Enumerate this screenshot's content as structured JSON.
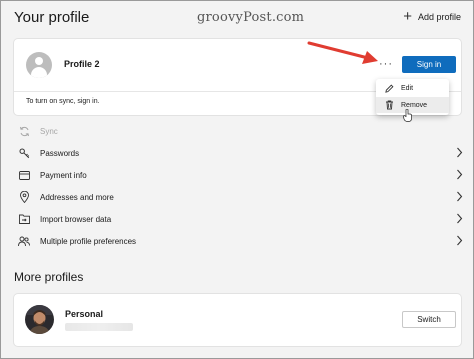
{
  "header": {
    "title": "Your profile",
    "watermark": "groovyPost.com",
    "add_profile_label": "Add profile"
  },
  "profile_card": {
    "name": "Profile 2",
    "more_label": "···",
    "sign_in_label": "Sign in",
    "sync_hint": "To turn on sync, sign in."
  },
  "menu": {
    "items": [
      {
        "label": "Edit",
        "icon": "pencil-icon"
      },
      {
        "label": "Remove",
        "icon": "trash-icon"
      }
    ]
  },
  "settings": {
    "items": [
      {
        "label": "Sync",
        "icon": "sync-icon",
        "disabled": true
      },
      {
        "label": "Passwords",
        "icon": "key-icon"
      },
      {
        "label": "Payment info",
        "icon": "credit-card-icon"
      },
      {
        "label": "Addresses and more",
        "icon": "location-pin-icon"
      },
      {
        "label": "Import browser data",
        "icon": "import-folder-icon"
      },
      {
        "label": "Multiple profile preferences",
        "icon": "people-icon"
      }
    ]
  },
  "more_profiles": {
    "title": "More profiles",
    "profile_name": "Personal",
    "switch_label": "Switch"
  },
  "colors": {
    "accent": "#0f6cbd",
    "arrow": "#e03c31"
  }
}
